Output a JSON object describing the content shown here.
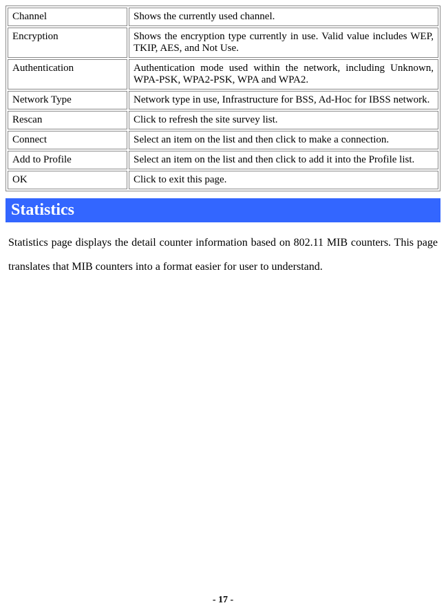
{
  "table": {
    "rows": [
      {
        "label": "Channel",
        "desc": "Shows the currently used channel."
      },
      {
        "label": "Encryption",
        "desc": "Shows the encryption type currently in use. Valid value includes WEP, TKIP, AES, and Not Use."
      },
      {
        "label": "Authentication",
        "desc": "Authentication mode used within the network, including Unknown, WPA-PSK, WPA2-PSK, WPA and WPA2."
      },
      {
        "label": "Network Type",
        "desc": "Network type in use, Infrastructure for BSS, Ad-Hoc for IBSS network."
      },
      {
        "label": "Rescan",
        "desc": "Click to refresh the site survey list."
      },
      {
        "label": "Connect",
        "desc": "Select an item on the list and then click to make a connection."
      },
      {
        "label": "Add to Profile",
        "desc": "Select an item on the list and then click to add it into the Profile list."
      },
      {
        "label": "OK",
        "desc": "Click to exit this page."
      }
    ]
  },
  "section": {
    "heading": "Statistics",
    "body": "Statistics page displays the detail counter information based on 802.11 MIB counters. This page translates that MIB counters into a format easier for user to understand."
  },
  "footer": {
    "page_number": "- 17 -"
  }
}
